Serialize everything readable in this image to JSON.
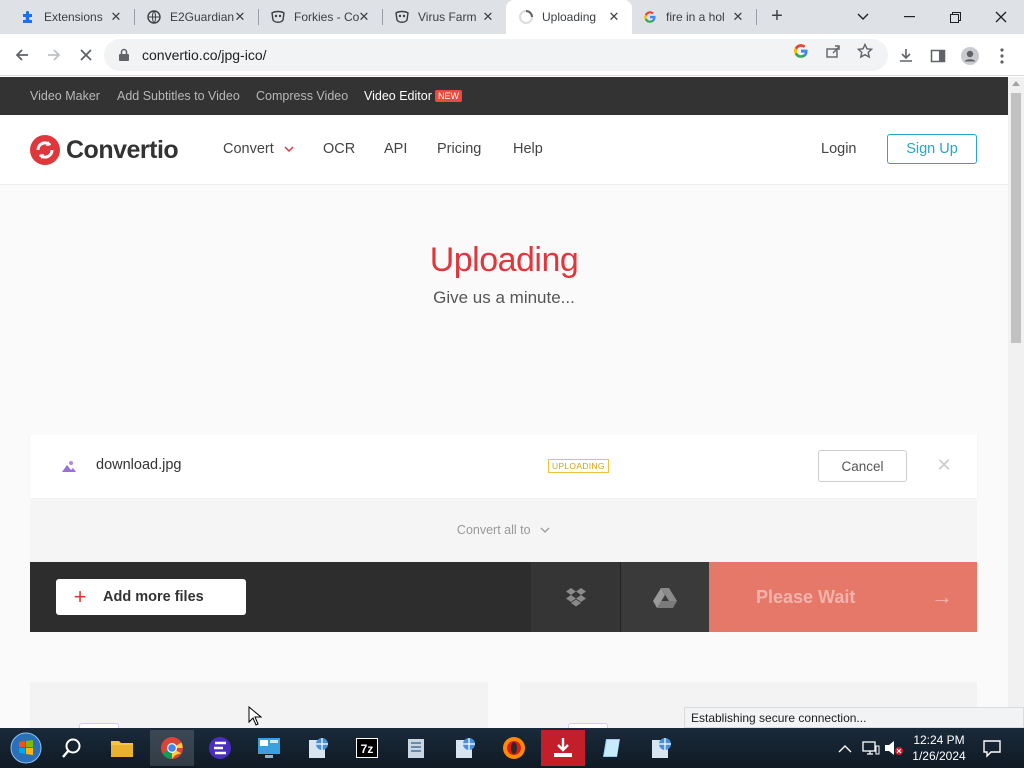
{
  "browser": {
    "tabs": [
      {
        "title": "Extensions",
        "icon": "puzzle-icon"
      },
      {
        "title": "E2Guardian",
        "icon": "globe-icon"
      },
      {
        "title": "Forkies - Co",
        "icon": "mask-icon"
      },
      {
        "title": "Virus Farm",
        "icon": "mask-icon"
      },
      {
        "title": "Uploading",
        "icon": "loading-spinner-icon",
        "active": true
      },
      {
        "title": "fire in a hol",
        "icon": "google-icon"
      }
    ],
    "url": "convertio.co/jpg-ico/",
    "status_text": "Establishing secure connection..."
  },
  "topbar": {
    "links": [
      "Video Maker",
      "Add Subtitles to Video",
      "Compress Video",
      "Video Editor"
    ],
    "badge": "NEW"
  },
  "header": {
    "logo": "Convertio",
    "nav": [
      "Convert",
      "OCR",
      "API",
      "Pricing",
      "Help"
    ],
    "login": "Login",
    "signup": "Sign Up"
  },
  "hero": {
    "title": "Uploading",
    "subtitle": "Give us a minute..."
  },
  "file": {
    "name": "download.jpg",
    "status": "UPLOADING",
    "cancel": "Cancel"
  },
  "convert_all": "Convert all to",
  "actions": {
    "add_files": "Add more files",
    "submit": "Please Wait"
  },
  "taskbar": {
    "time": "12:24 PM",
    "date": "1/26/2024"
  },
  "colors": {
    "brand_red": "#e0373d",
    "signup_blue": "#29a6c7",
    "badge_yellow": "#f0c33c",
    "please_wait": "#e6786a"
  }
}
